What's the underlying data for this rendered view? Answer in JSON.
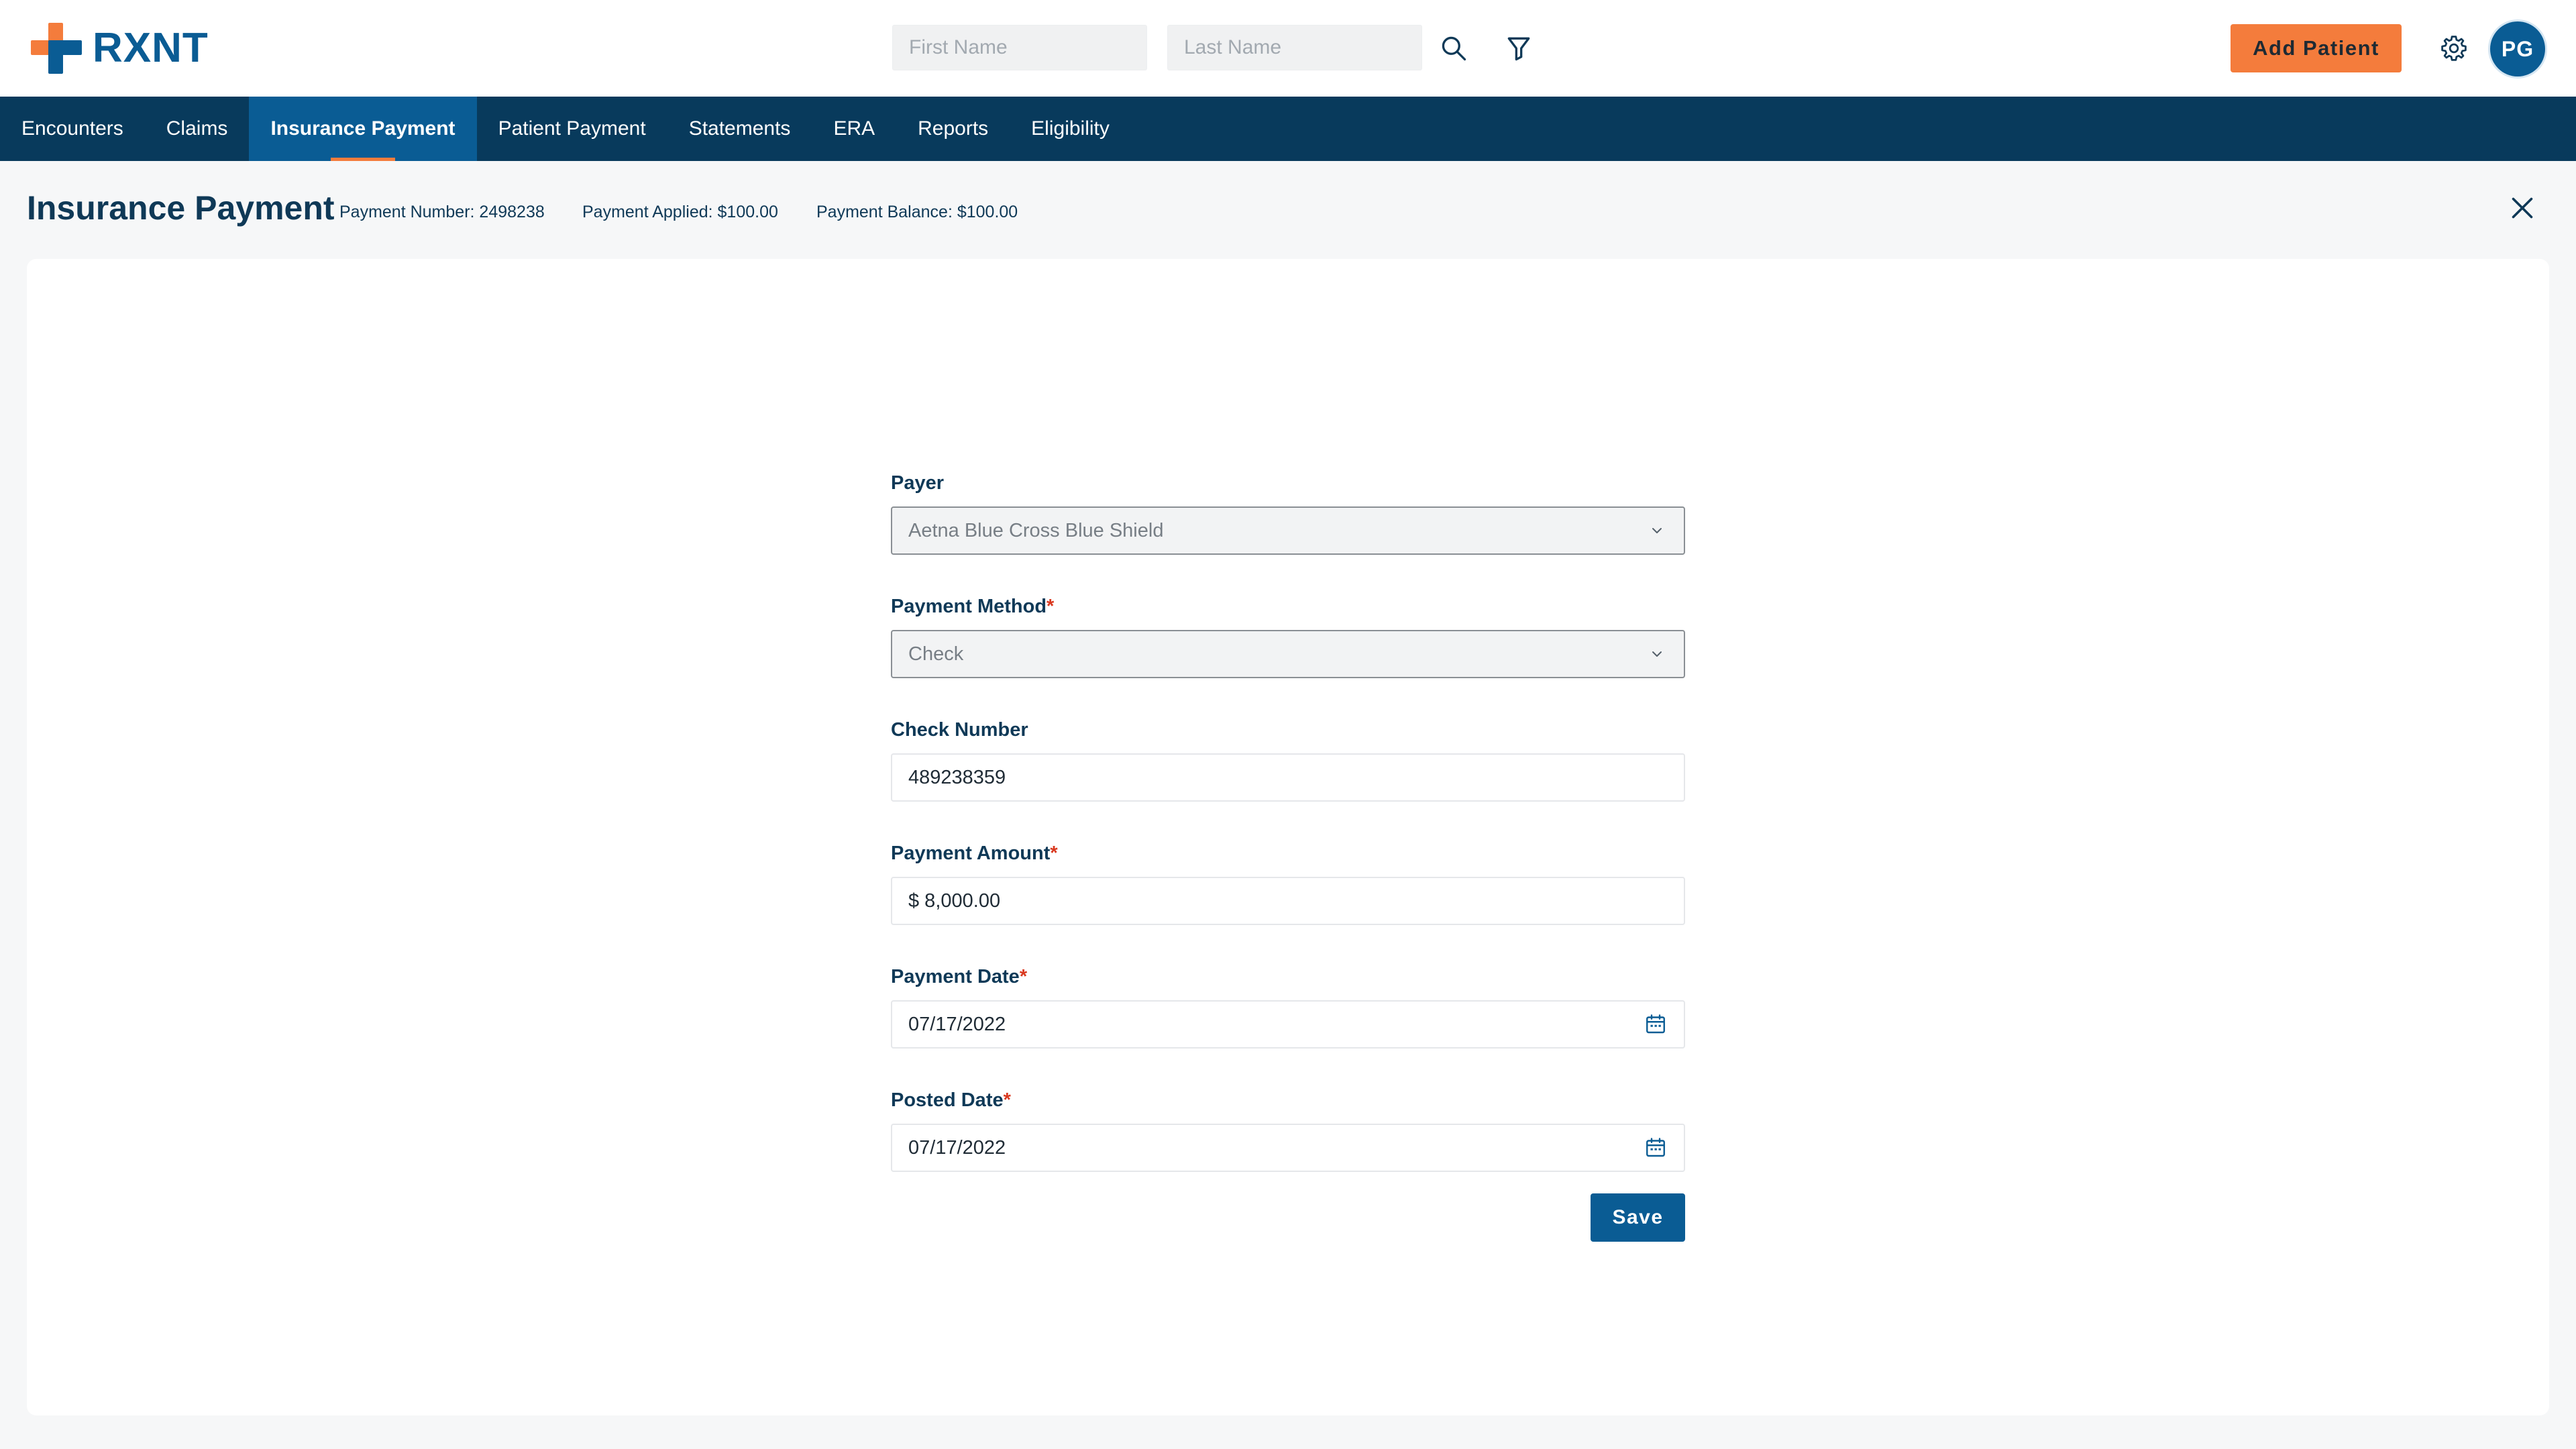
{
  "brand": {
    "name": "RXNT"
  },
  "header": {
    "first_name_placeholder": "First Name",
    "last_name_placeholder": "Last Name",
    "search_icon": "search-icon",
    "filter_icon": "filter-icon",
    "add_patient_label": "Add Patient",
    "settings_icon": "gear-icon",
    "avatar_initials": "PG"
  },
  "nav": {
    "items": [
      {
        "label": "Encounters"
      },
      {
        "label": "Claims"
      },
      {
        "label": "Insurance Payment",
        "active": true
      },
      {
        "label": "Patient Payment"
      },
      {
        "label": "Statements"
      },
      {
        "label": "ERA"
      },
      {
        "label": "Reports"
      },
      {
        "label": "Eligibility"
      }
    ]
  },
  "page": {
    "title": "Insurance Payment",
    "payment_number_label": "Payment Number: ",
    "payment_number": "2498238",
    "payment_applied_label": "Payment Applied: ",
    "payment_applied": "$100.00",
    "payment_balance_label": "Payment Balance: ",
    "payment_balance": "$100.00"
  },
  "form": {
    "payer": {
      "label": "Payer",
      "value": "Aetna Blue Cross Blue Shield"
    },
    "payment_method": {
      "label": "Payment Method",
      "required_mark": "*",
      "value": "Check"
    },
    "check_number": {
      "label": "Check Number",
      "value": "489238359"
    },
    "payment_amount": {
      "label": "Payment Amount",
      "required_mark": "*",
      "value": "$ 8,000.00"
    },
    "payment_date": {
      "label": "Payment Date",
      "required_mark": "*",
      "value": "07/17/2022"
    },
    "posted_date": {
      "label": "Posted Date",
      "required_mark": "*",
      "value": "07/17/2022"
    },
    "save_label": "Save"
  },
  "colors": {
    "brand_blue": "#0a5c94",
    "nav_dark": "#083a5c",
    "accent_orange": "#f47c3c",
    "required_red": "#d9381e"
  }
}
